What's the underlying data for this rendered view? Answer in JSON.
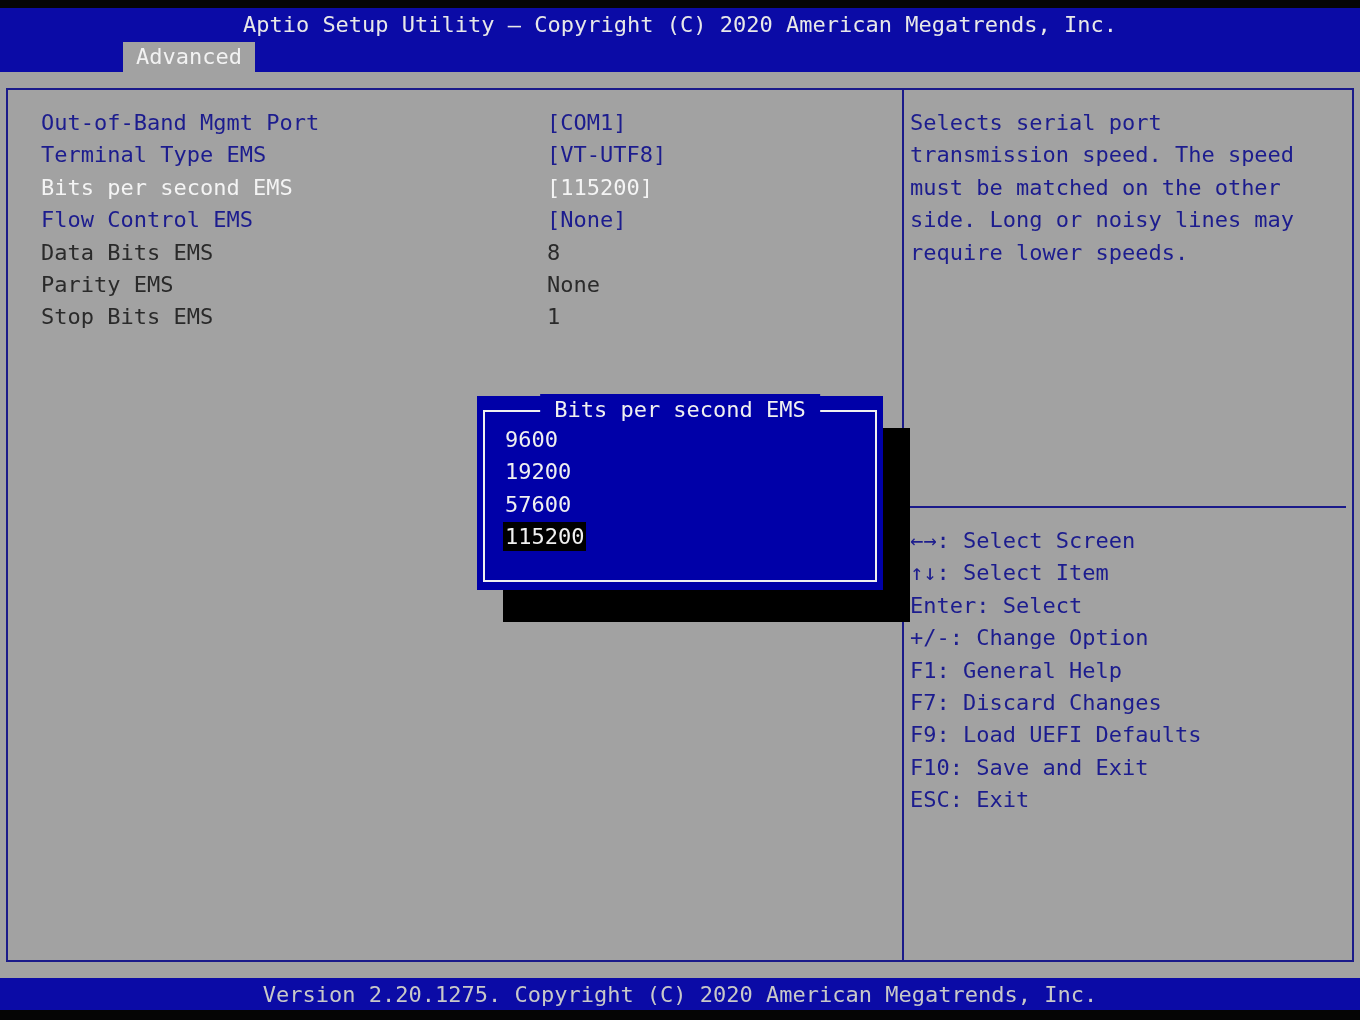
{
  "header": {
    "title": "Aptio Setup Utility – Copyright (C) 2020 American Megatrends, Inc."
  },
  "tabs": [
    {
      "label": "Advanced",
      "selected": true
    }
  ],
  "settings": [
    {
      "label": "Out-of-Band Mgmt Port",
      "value": "[COM1]",
      "kind": "option",
      "selected": false
    },
    {
      "label": "Terminal Type EMS",
      "value": "[VT-UTF8]",
      "kind": "option",
      "selected": false
    },
    {
      "label": "Bits per second EMS",
      "value": "[115200]",
      "kind": "option",
      "selected": true
    },
    {
      "label": "Flow Control EMS",
      "value": "[None]",
      "kind": "option",
      "selected": false
    },
    {
      "label": "Data Bits EMS",
      "value": "8",
      "kind": "info",
      "selected": false
    },
    {
      "label": "Parity EMS",
      "value": "None",
      "kind": "info",
      "selected": false
    },
    {
      "label": "Stop Bits EMS",
      "value": "1",
      "kind": "info",
      "selected": false
    }
  ],
  "help_text": "Selects serial port transmission speed. The speed must be matched on the other side. Long or noisy lines may require lower speeds.",
  "hotkeys": [
    "←→: Select Screen",
    "↑↓: Select Item",
    "Enter: Select",
    "+/-: Change Option",
    "F1: General Help",
    "F7: Discard Changes",
    "F9: Load UEFI Defaults",
    "F10: Save and Exit",
    "ESC: Exit"
  ],
  "popup": {
    "title": "Bits per second EMS",
    "options": [
      {
        "label": "9600",
        "selected": false
      },
      {
        "label": "19200",
        "selected": false
      },
      {
        "label": "57600",
        "selected": false
      },
      {
        "label": "115200",
        "selected": true
      }
    ]
  },
  "footer": {
    "text": "Version 2.20.1275. Copyright (C) 2020 American Megatrends, Inc."
  }
}
